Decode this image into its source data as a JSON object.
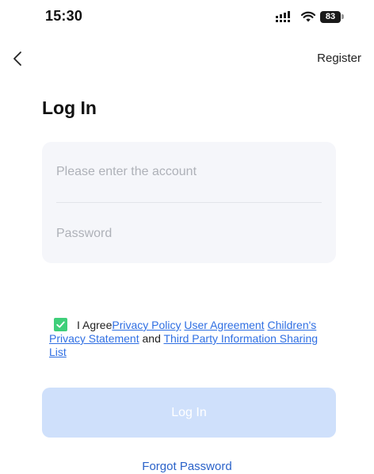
{
  "status_bar": {
    "time": "15:30",
    "battery": "83",
    "icons": [
      "signal-icon",
      "wifi-icon",
      "battery-icon"
    ]
  },
  "nav": {
    "back_icon": "chevron-left-icon",
    "register_label": "Register"
  },
  "page": {
    "title": "Log In"
  },
  "form": {
    "account_placeholder": "Please enter the account",
    "account_value": "",
    "password_placeholder": "Password",
    "password_value": ""
  },
  "agreement": {
    "checked": true,
    "prefix": "I Agree",
    "privacy_policy": "Privacy Policy",
    "user_agreement": "User Agreement",
    "childrens_privacy": "Children's Privacy Statement",
    "and_text": "and",
    "third_party": "Third Party Information Sharing List"
  },
  "actions": {
    "login_label": "Log In",
    "forgot_password_label": "Forgot Password"
  },
  "colors": {
    "accent": "#2f6fe3",
    "checkbox": "#3fcf7a",
    "login_disabled": "#cfe0fb",
    "card_background": "#f5f6fa"
  }
}
